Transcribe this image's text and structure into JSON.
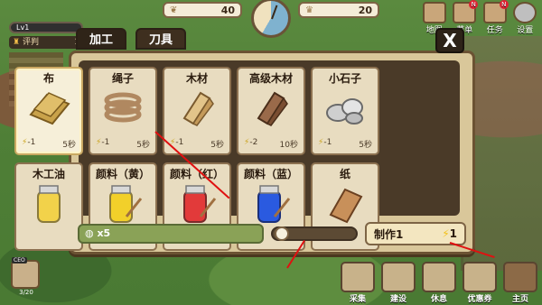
{
  "hud": {
    "resource_left": {
      "icon": "sprout-icon",
      "value": "40"
    },
    "resource_right": {
      "icon": "crown-icon",
      "value": "20"
    },
    "level_label": "Lv1",
    "rating_label": "评判",
    "rating_value": "1"
  },
  "top_menu": [
    {
      "label": "地图",
      "icon": "map-icon",
      "badge": ""
    },
    {
      "label": "菜单",
      "icon": "menu-icon",
      "badge": "N"
    },
    {
      "label": "任务",
      "icon": "quest-icon",
      "badge": "N"
    },
    {
      "label": "设置",
      "icon": "gear-icon",
      "badge": ""
    }
  ],
  "panel": {
    "tabs": [
      "加工",
      "刀具"
    ],
    "close_label": "X",
    "items": [
      {
        "name": "布",
        "energy": "-1",
        "time": "5秒",
        "selected": true,
        "icon": "cloth-icon"
      },
      {
        "name": "绳子",
        "energy": "-1",
        "time": "5秒",
        "selected": false,
        "icon": "rope-icon"
      },
      {
        "name": "木材",
        "energy": "-1",
        "time": "5秒",
        "selected": false,
        "icon": "lumber-icon"
      },
      {
        "name": "高级木材",
        "energy": "-2",
        "time": "10秒",
        "selected": false,
        "icon": "dark-lumber-icon"
      },
      {
        "name": "小石子",
        "energy": "-1",
        "time": "5秒",
        "selected": false,
        "icon": "pebbles-icon"
      },
      {
        "name": "木工油",
        "energy": "",
        "time": "",
        "selected": false,
        "icon": "oil-jar-icon"
      },
      {
        "name": "颜料（黄）",
        "energy": "",
        "time": "",
        "selected": false,
        "icon": "yellow-paint-icon"
      },
      {
        "name": "颜料（红）",
        "energy": "",
        "time": "",
        "selected": false,
        "icon": "red-paint-icon"
      },
      {
        "name": "颜料（蓝）",
        "energy": "",
        "time": "",
        "selected": false,
        "icon": "blue-paint-icon"
      },
      {
        "name": "纸",
        "energy": "",
        "time": "",
        "selected": false,
        "icon": "paper-icon"
      }
    ],
    "material_count": "x5",
    "quantity_fraction": 0.0,
    "make_button": {
      "label": "制作1",
      "energy_cost": "1"
    }
  },
  "bottom_nav": [
    {
      "label": "采集",
      "icon": "gather-icon"
    },
    {
      "label": "建设",
      "icon": "build-icon"
    },
    {
      "label": "休息",
      "icon": "rest-icon"
    },
    {
      "label": "优惠券",
      "icon": "coupon-icon"
    },
    {
      "label": "主页",
      "icon": "home-icon"
    }
  ],
  "ceo": {
    "tag": "CEO",
    "count": "3/20"
  },
  "colors": {
    "accent_energy": "#f2c01a",
    "panel_bg": "#d9c79a",
    "panel_dark": "#4a3a28",
    "arrow": "#e01010"
  }
}
